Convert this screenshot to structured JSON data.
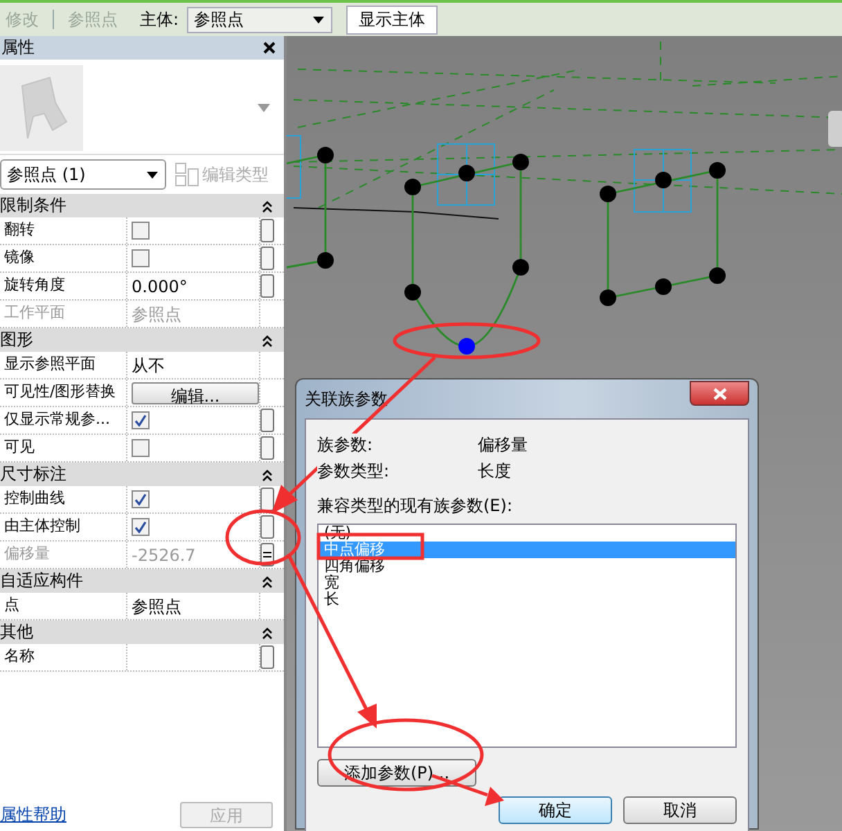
{
  "toolbar": {
    "breadcrumb": [
      "修改",
      "参照点"
    ],
    "host_label": "主体:",
    "host_value": "参照点",
    "show_host_button": "显示主体"
  },
  "properties": {
    "title": "属性",
    "type_selector": "参照点 (1)",
    "edit_type_button": {
      "label": "编辑类型",
      "disabled": true
    },
    "groups": [
      {
        "title": "限制条件",
        "expanded": true,
        "rows": [
          {
            "label": "翻转",
            "kind": "checkbox",
            "checked": false,
            "disabled": false,
            "param_button": true,
            "linked": false
          },
          {
            "label": "镜像",
            "kind": "checkbox",
            "checked": false,
            "disabled": false,
            "param_button": true,
            "linked": false
          },
          {
            "label": "旋转角度",
            "kind": "text",
            "value": "0.000°",
            "disabled": false,
            "param_button": true,
            "linked": false
          },
          {
            "label": "工作平面",
            "kind": "text",
            "value": "参照点",
            "disabled": true,
            "param_button": false
          }
        ]
      },
      {
        "title": "图形",
        "expanded": true,
        "rows": [
          {
            "label": "显示参照平面",
            "kind": "text",
            "value": "从不",
            "disabled": false,
            "param_button": false
          },
          {
            "label": "可见性/图形替换",
            "kind": "button",
            "value": "编辑...",
            "disabled": false,
            "param_button": false
          },
          {
            "label": "仅显示常规参...",
            "kind": "checkbox",
            "checked": true,
            "disabled": false,
            "param_button": true,
            "linked": false
          },
          {
            "label": "可见",
            "kind": "checkbox",
            "checked": false,
            "disabled": false,
            "param_button": true,
            "linked": false
          }
        ]
      },
      {
        "title": "尺寸标注",
        "expanded": true,
        "rows": [
          {
            "label": "控制曲线",
            "kind": "checkbox",
            "checked": true,
            "disabled": false,
            "param_button": true,
            "linked": false
          },
          {
            "label": "由主体控制",
            "kind": "checkbox",
            "checked": true,
            "disabled": false,
            "param_button": true,
            "linked": false
          },
          {
            "label": "偏移量",
            "kind": "text",
            "value": "-2526.7",
            "disabled": true,
            "param_button": true,
            "linked": true
          }
        ]
      },
      {
        "title": "自适应构件",
        "expanded": true,
        "rows": [
          {
            "label": "点",
            "kind": "text",
            "value": "参照点",
            "disabled": false,
            "param_button": false
          }
        ]
      },
      {
        "title": "其他",
        "expanded": true,
        "rows": [
          {
            "label": "名称",
            "kind": "text",
            "value": "",
            "disabled": false,
            "param_button": true,
            "linked": false
          }
        ]
      }
    ],
    "help_link": "属性帮助",
    "apply_button": {
      "label": "应用",
      "disabled": true
    }
  },
  "dialog": {
    "title": "关联族参数",
    "fields": [
      {
        "label": "族参数:",
        "value": "偏移量"
      },
      {
        "label": "参数类型:",
        "value": "长度"
      }
    ],
    "list_label": "兼容类型的现有族参数(E):",
    "items": [
      {
        "label": "(无)",
        "selected": false
      },
      {
        "label": "中点偏移",
        "selected": true
      },
      {
        "label": "四角偏移",
        "selected": false
      },
      {
        "label": "宽",
        "selected": false
      },
      {
        "label": "长",
        "selected": false
      }
    ],
    "add_button": "添加参数(P)...",
    "ok_button": "确定",
    "cancel_button": "取消"
  }
}
